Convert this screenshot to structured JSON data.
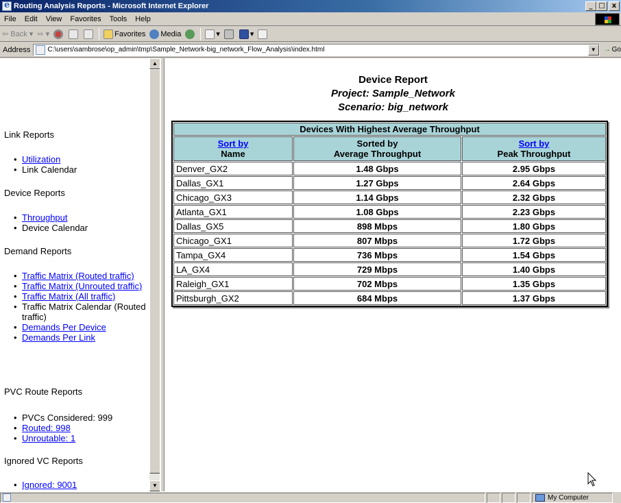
{
  "window": {
    "title": "Routing Analysis Reports - Microsoft Internet Explorer",
    "minimize": "_",
    "maximize": "□",
    "close": "x"
  },
  "menu": {
    "items": [
      {
        "label": "File"
      },
      {
        "label": "Edit"
      },
      {
        "label": "View"
      },
      {
        "label": "Favorites"
      },
      {
        "label": "Tools"
      },
      {
        "label": "Help"
      }
    ]
  },
  "toolbar": {
    "back": "Back",
    "favorites": "Favorites",
    "media": "Media"
  },
  "address": {
    "label": "Address",
    "url": "C:\\users\\sambrose\\op_admin\\tmp\\Sample_Network-big_network_Flow_Analysis\\index.html",
    "go": "Go"
  },
  "nav": {
    "link_reports": {
      "heading": "Link Reports",
      "items": [
        {
          "label": "Utilization",
          "link": true
        },
        {
          "label": "Link Calendar",
          "link": false
        }
      ]
    },
    "device_reports": {
      "heading": "Device Reports",
      "items": [
        {
          "label": "Throughput",
          "link": true
        },
        {
          "label": "Device Calendar",
          "link": false
        }
      ]
    },
    "demand_reports": {
      "heading": "Demand Reports",
      "items": [
        {
          "label": "Traffic Matrix (Routed traffic)",
          "link": true
        },
        {
          "label": "Traffic Matrix (Unrouted traffic)",
          "link": true
        },
        {
          "label": "Traffic Matrix (All traffic)",
          "link": true
        },
        {
          "label": "Traffic Matrix Calendar (Routed traffic)",
          "link": false
        },
        {
          "label": "Demands Per Device",
          "link": true
        },
        {
          "label": "Demands Per Link",
          "link": true
        }
      ]
    },
    "pvc_reports": {
      "heading": "PVC Route Reports",
      "items": [
        {
          "label": "PVCs Considered: 999",
          "link": false
        },
        {
          "label": "Routed: 998",
          "link": true
        },
        {
          "label": "Unroutable: 1",
          "link": true
        }
      ]
    },
    "ignored_reports": {
      "heading": "Ignored VC Reports",
      "items": [
        {
          "label": "Ignored: 9001",
          "link": true
        }
      ]
    }
  },
  "report": {
    "title": "Device Report",
    "project": "Project: Sample_Network",
    "scenario": "Scenario: big_network",
    "table_caption": "Devices With Highest Average Throughput",
    "columns": {
      "name_sort": "Sort by",
      "name": "Name",
      "avg_sorted": "Sorted by",
      "avg": "Average Throughput",
      "peak_sort": "Sort by",
      "peak": "Peak Throughput"
    },
    "rows": [
      {
        "name": "Denver_GX2",
        "avg": "1.48 Gbps",
        "peak": "2.95 Gbps"
      },
      {
        "name": "Dallas_GX1",
        "avg": "1.27 Gbps",
        "peak": "2.64 Gbps"
      },
      {
        "name": "Chicago_GX3",
        "avg": "1.14 Gbps",
        "peak": "2.32 Gbps"
      },
      {
        "name": "Atlanta_GX1",
        "avg": "1.08 Gbps",
        "peak": "2.23 Gbps"
      },
      {
        "name": "Dallas_GX5",
        "avg": "898 Mbps",
        "peak": "1.80 Gbps"
      },
      {
        "name": "Chicago_GX1",
        "avg": "807 Mbps",
        "peak": "1.72 Gbps"
      },
      {
        "name": "Tampa_GX4",
        "avg": "736 Mbps",
        "peak": "1.54 Gbps"
      },
      {
        "name": "LA_GX4",
        "avg": "729 Mbps",
        "peak": "1.40 Gbps"
      },
      {
        "name": "Raleigh_GX1",
        "avg": "702 Mbps",
        "peak": "1.35 Gbps"
      },
      {
        "name": "Pittsburgh_GX2",
        "avg": "684 Mbps",
        "peak": "1.37 Gbps"
      }
    ]
  },
  "status": {
    "zone": "My Computer"
  }
}
